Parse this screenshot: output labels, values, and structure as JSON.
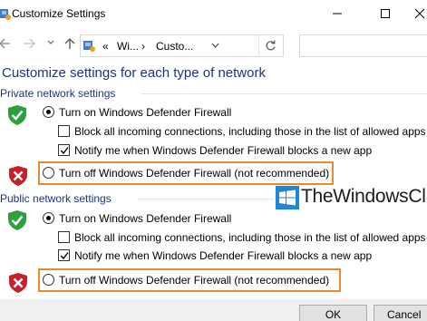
{
  "window": {
    "title": "Customize Settings",
    "minimize_icon": "minimize-icon",
    "maximize_icon": "maximize-icon",
    "close_icon": "close-icon"
  },
  "nav": {
    "back_icon": "back-arrow-icon",
    "forward_icon": "forward-arrow-icon",
    "up_icon": "up-arrow-icon",
    "breadcrumb_sep": "«",
    "breadcrumb_1": "Wi...",
    "breadcrumb_arrow": "›",
    "breadcrumb_2": "Custo...",
    "breadcrumb_dropdown": "dropdown-icon",
    "refresh_icon": "refresh-icon"
  },
  "heading": "Customize settings for each type of network",
  "private": {
    "title": "Private network settings",
    "turn_on": "Turn on Windows Defender Firewall",
    "block_all": "Block all incoming connections, including those in the list of allowed apps",
    "notify": "Notify me when Windows Defender Firewall blocks a new app",
    "turn_off": "Turn off Windows Defender Firewall (not recommended)"
  },
  "public": {
    "title": "Public network settings",
    "turn_on": "Turn on Windows Defender Firewall",
    "block_all": "Block all incoming connections, including those in the list of allowed apps",
    "notify": "Notify me when Windows Defender Firewall blocks a new app",
    "turn_off": "Turn off Windows Defender Firewall (not recommended)"
  },
  "watermark": "TheWindowsClub",
  "buttons": {
    "ok": "OK",
    "cancel": "Cancel"
  },
  "colors": {
    "heading_blue": "#1e3287",
    "highlight_orange": "#e8892d",
    "shield_green": "#2e9e3e",
    "shield_red": "#c8202a"
  }
}
